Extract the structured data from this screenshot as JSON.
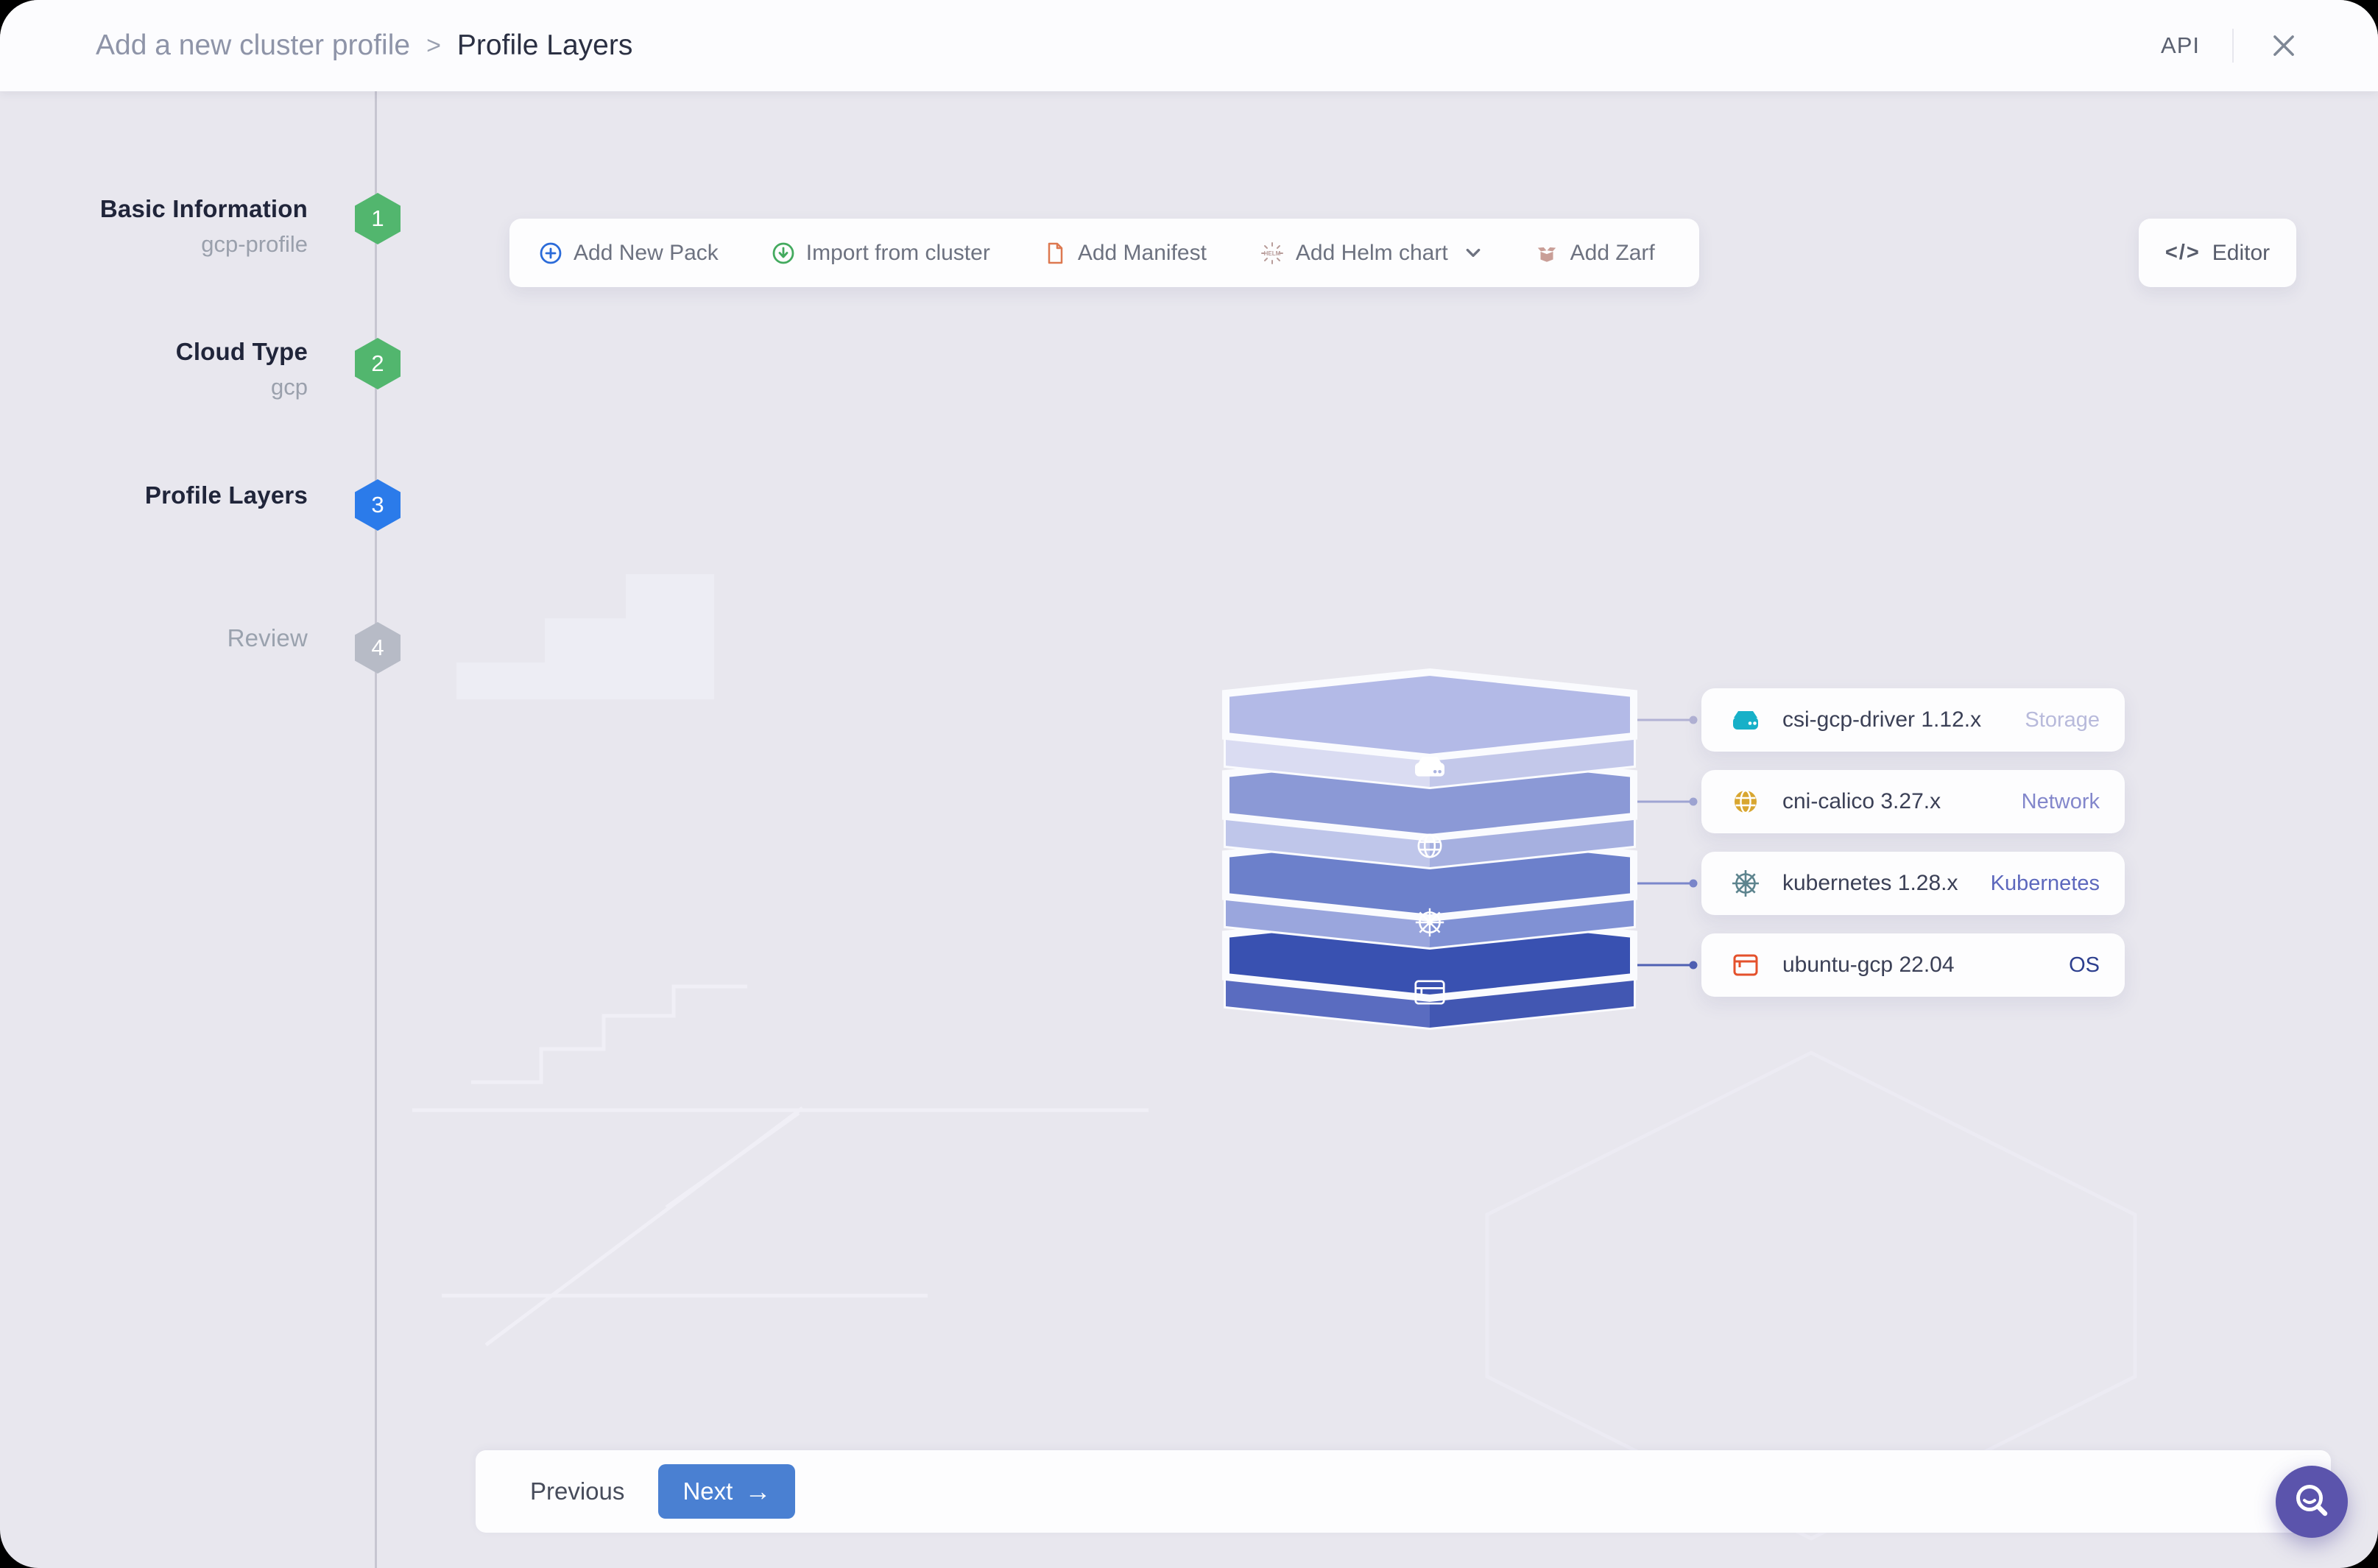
{
  "header": {
    "breadcrumb": {
      "parent": "Add a new cluster profile",
      "separator": ">",
      "current": "Profile Layers"
    },
    "api_label": "API"
  },
  "wizard": {
    "steps": [
      {
        "number": "1",
        "label": "Basic Information",
        "sublabel": "gcp-profile",
        "status": "completed",
        "badge_color": "#52b66e"
      },
      {
        "number": "2",
        "label": "Cloud Type",
        "sublabel": "gcp",
        "status": "completed",
        "badge_color": "#52b66e"
      },
      {
        "number": "3",
        "label": "Profile Layers",
        "status": "active",
        "badge_color": "#2b7bea"
      },
      {
        "number": "4",
        "label": "Review",
        "status": "upcoming",
        "badge_color": "#b7bbc6"
      }
    ]
  },
  "toolbar": {
    "items": [
      {
        "label": "Add New Pack",
        "icon": "plus-circle-icon",
        "icon_color": "#2b6bd9"
      },
      {
        "label": "Import from cluster",
        "icon": "download-circle-icon",
        "icon_color": "#43aa5e"
      },
      {
        "label": "Add Manifest",
        "icon": "manifest-file-icon",
        "icon_color": "#dd7850"
      },
      {
        "label": "Add Helm chart",
        "icon": "helm-wheel-icon",
        "icon_text": "HELM",
        "icon_color": "#b89c9a",
        "has_dropdown": true
      },
      {
        "label": "Add Zarf",
        "icon": "zarf-package-icon",
        "icon_color": "#c99e97"
      }
    ],
    "editor": {
      "label": "Editor",
      "glyph": "</>",
      "icon": "code-icon"
    }
  },
  "layers": [
    {
      "name": "csi-gcp-driver 1.12.x",
      "category": "Storage",
      "icon": "storage-drive-icon",
      "icon_color": "#17b0c8",
      "category_color": "#b8badb"
    },
    {
      "name": "cni-calico 3.27.x",
      "category": "Network",
      "icon": "globe-icon",
      "icon_color": "#d8a630",
      "category_color": "#8387cb"
    },
    {
      "name": "kubernetes 1.28.x",
      "category": "Kubernetes",
      "icon": "kubernetes-wheel-icon",
      "icon_color": "#5d848e",
      "category_color": "#5d68bd"
    },
    {
      "name": "ubuntu-gcp 22.04",
      "category": "OS",
      "icon": "os-window-icon",
      "icon_color": "#e4512c",
      "category_color": "#2d3f8e"
    }
  ],
  "footer": {
    "previous_label": "Previous",
    "next_label": "Next",
    "next_arrow": "→"
  },
  "fab": {
    "icon": "search-feedback-icon",
    "color": "#5b54ac"
  },
  "colors": {
    "background": "#e8e7ee",
    "surface": "#fdfdfe",
    "rail": "#c7c6d1",
    "accent_blue": "#4a80d2",
    "step_green": "#52b66e",
    "step_active_blue": "#2b7bea",
    "step_gray": "#b7bbc6"
  }
}
